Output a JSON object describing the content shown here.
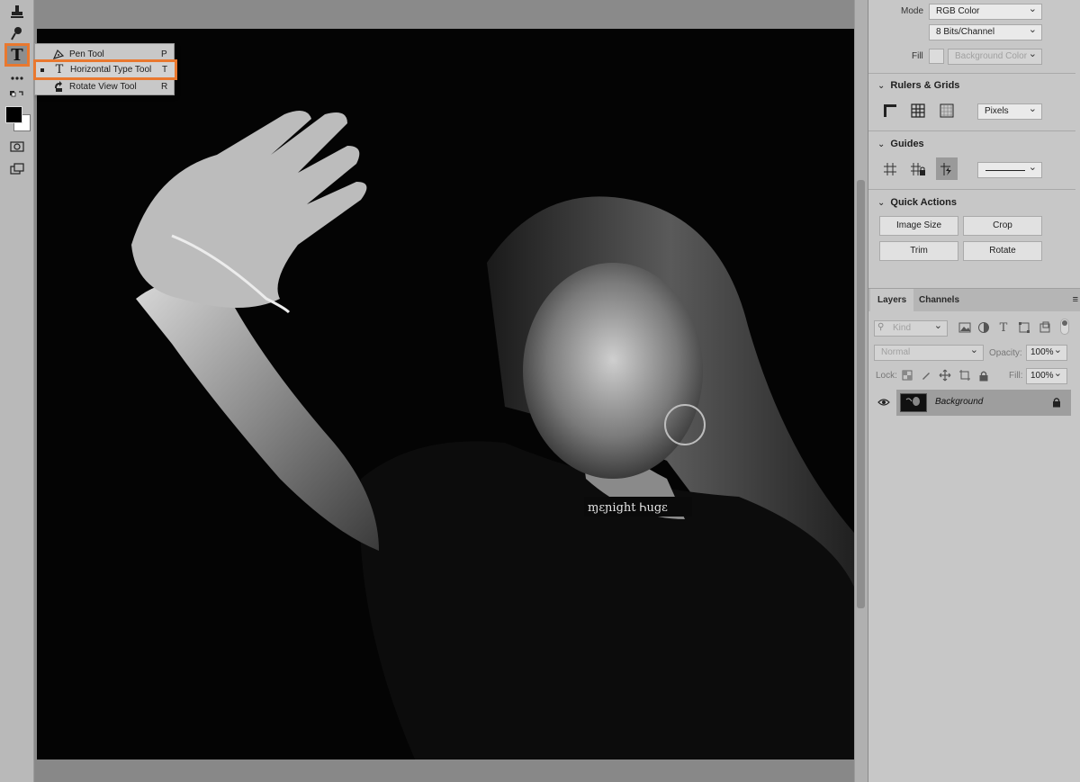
{
  "toolbar": {
    "tools": [
      "stamp-tool",
      "dodge-tool",
      "type-tool",
      "more-tools",
      "swap-colors",
      "quick-mask",
      "screen-mode"
    ],
    "type_tool_glyph": "T",
    "foreground_color": "#000000",
    "background_color": "#ffffff"
  },
  "flyout": {
    "items": [
      {
        "label": "Pen Tool",
        "shortcut": "P",
        "icon": "pen-icon"
      },
      {
        "label": "Horizontal Type Tool",
        "shortcut": "T",
        "icon": "type-icon",
        "glyph": "T"
      },
      {
        "label": "Rotate View Tool",
        "shortcut": "R",
        "icon": "rotate-view-icon"
      }
    ]
  },
  "properties": {
    "mode_label": "Mode",
    "mode_value": "RGB Color",
    "bits_value": "8 Bits/Channel",
    "fill_label": "Fill",
    "fill_value": "Background Color",
    "rulers_title": "Rulers & Grids",
    "units_value": "Pixels",
    "guides_title": "Guides",
    "quick_actions_title": "Quick Actions",
    "buttons": [
      "Image Size",
      "Crop",
      "Trim",
      "Rotate"
    ]
  },
  "layers": {
    "tabs": [
      "Layers",
      "Channels"
    ],
    "filter_placeholder": "Kind",
    "blend_mode": "Normal",
    "opacity_label": "Opacity:",
    "opacity_value": "100%",
    "lock_label": "Lock:",
    "fill_label": "Fill:",
    "fill_value": "100%",
    "layer_name": "Background"
  },
  "colors": {
    "highlight": "#e9782f",
    "panel_bg": "#c7c7c7",
    "toolbar_bg": "#b9b9b9"
  }
}
